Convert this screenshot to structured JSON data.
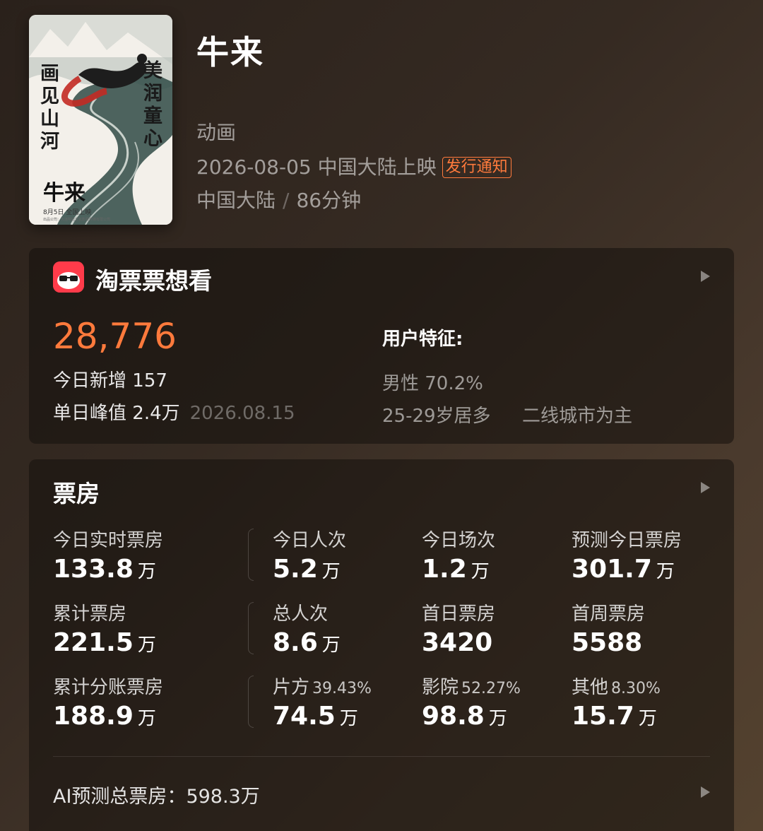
{
  "poster": {
    "left_text": "画见山河",
    "right_text": "美润童心",
    "title": "牛来",
    "date_line": "8月5日 全国上映",
    "fine_print": "出品公司：大连明远文化影视传媒有限公司"
  },
  "movie": {
    "title": "牛来",
    "genre": "动画",
    "release": "2026-08-05 中国大陆上映",
    "release_badge": "发行通知",
    "region": "中国大陆",
    "region_sep": "/",
    "duration": "86分钟"
  },
  "want_to_see": {
    "title": "淘票票想看",
    "count": "28,776",
    "today_new_label": "今日新增",
    "today_new_value": "157",
    "peak_label": "单日峰值",
    "peak_value": "2.4万",
    "peak_date": "2026.08.15",
    "features_title": "用户特征:",
    "feature_gender": "男性 70.2%",
    "feature_age": "25-29岁居多",
    "feature_city": "二线城市为主"
  },
  "box_office": {
    "title": "票房",
    "rows": [
      [
        {
          "label": "今日实时票房",
          "pct": "",
          "value": "133.8",
          "unit": "万"
        },
        {
          "label": "今日人次",
          "pct": "",
          "value": "5.2",
          "unit": "万"
        },
        {
          "label": "今日场次",
          "pct": "",
          "value": "1.2",
          "unit": "万"
        },
        {
          "label": "预测今日票房",
          "pct": "",
          "value": "301.7",
          "unit": "万"
        }
      ],
      [
        {
          "label": "累计票房",
          "pct": "",
          "value": "221.5",
          "unit": "万"
        },
        {
          "label": "总人次",
          "pct": "",
          "value": "8.6",
          "unit": "万"
        },
        {
          "label": "首日票房",
          "pct": "",
          "value": "3420",
          "unit": ""
        },
        {
          "label": "首周票房",
          "pct": "",
          "value": "5588",
          "unit": ""
        }
      ],
      [
        {
          "label": "累计分账票房",
          "pct": "",
          "value": "188.9",
          "unit": "万"
        },
        {
          "label": "片方",
          "pct": "39.43%",
          "value": "74.5",
          "unit": "万"
        },
        {
          "label": "影院",
          "pct": "52.27%",
          "value": "98.8",
          "unit": "万"
        },
        {
          "label": "其他",
          "pct": "8.30%",
          "value": "15.7",
          "unit": "万"
        }
      ]
    ],
    "ai_label": "AI预测总票房：",
    "ai_value": "598.3万"
  },
  "colors": {
    "accent": "#ff7a3c",
    "logo_red": "#ff3b4a"
  }
}
